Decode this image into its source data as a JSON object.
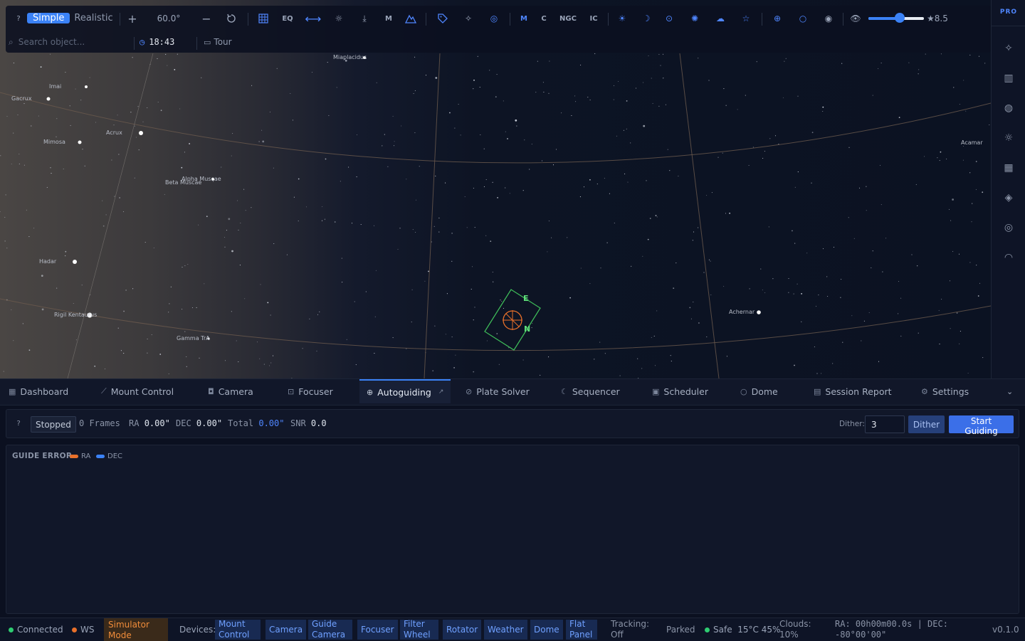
{
  "toolbar": {
    "help": "?",
    "mode_simple": "Simple",
    "mode_realistic": "Realistic",
    "zoom_in": "+",
    "fov": "60.0°",
    "zoom_out": "−",
    "eq_label": "EQ",
    "m_label": "M",
    "m_catalog": "M",
    "c_catalog": "C",
    "ngc_catalog": "NGC",
    "ic_catalog": "IC",
    "mag_limit": "★8.5",
    "mag_slider_value": 0.56,
    "search_placeholder": "Search object...",
    "time": "18:43",
    "tour": "Tour",
    "accent": "#3b82f6"
  },
  "rightbar": {
    "badge": "PRO"
  },
  "sky": {
    "stars": [
      {
        "name": "Miaplacidus"
      },
      {
        "name": "Imai"
      },
      {
        "name": "Gacrux"
      },
      {
        "name": "Acrux"
      },
      {
        "name": "Mimosa"
      },
      {
        "name": "Alpha Muscae"
      },
      {
        "name": "Beta Muscae"
      },
      {
        "name": "Hadar"
      },
      {
        "name": "Rigil Kentaurus"
      },
      {
        "name": "Gamma TrA"
      },
      {
        "name": "Achernar"
      },
      {
        "name": "Acamar"
      }
    ],
    "fov_labels": {
      "east": "E",
      "north": "N"
    }
  },
  "tabs": [
    {
      "label": "Dashboard",
      "icon": "grid-icon"
    },
    {
      "label": "Mount Control",
      "icon": "telescope-icon"
    },
    {
      "label": "Camera",
      "icon": "camera-icon"
    },
    {
      "label": "Focuser",
      "icon": "focus-icon"
    },
    {
      "label": "Autoguiding",
      "icon": "crosshair-icon",
      "active": true
    },
    {
      "label": "Plate Solver",
      "icon": "compass-icon"
    },
    {
      "label": "Sequencer",
      "icon": "moon-icon"
    },
    {
      "label": "Scheduler",
      "icon": "calendar-icon"
    },
    {
      "label": "Dome",
      "icon": "circle-icon"
    },
    {
      "label": "Session Report",
      "icon": "clipboard-icon"
    },
    {
      "label": "Settings",
      "icon": "gear-icon"
    }
  ],
  "guiding": {
    "help": "?",
    "state": "Stopped",
    "frames": "0 Frames",
    "ra_label": "RA",
    "ra_value": "0.00\"",
    "dec_label": "DEC",
    "dec_value": "0.00\"",
    "total_label": "Total",
    "total_value": "0.00\"",
    "snr_label": "SNR",
    "snr_value": "0.0",
    "dither_label": "Dither:",
    "dither_value": "3",
    "dither_button": "Dither",
    "start_button": "Start Guiding"
  },
  "chart": {
    "title": "GUIDE ERROR",
    "legend": [
      {
        "name": "RA",
        "color": "#e8702a"
      },
      {
        "name": "DEC",
        "color": "#3b82f6"
      }
    ]
  },
  "footer": {
    "connected": "Connected",
    "ws": "WS",
    "simulator": "Simulator Mode",
    "devices_label": "Devices:",
    "devices": [
      "Mount Control",
      "Camera",
      "Guide Camera",
      "Focuser",
      "Filter Wheel",
      "Rotator",
      "Weather",
      "Dome",
      "Flat Panel"
    ],
    "tracking": "Tracking: Off",
    "parked": "Parked",
    "safe": "Safe",
    "temp": "15°C",
    "humidity": "45%",
    "clouds": "Clouds: 10%",
    "coords": "RA: 00h00m00.0s | DEC: -80°00'00\"",
    "version": "v0.1.0"
  }
}
